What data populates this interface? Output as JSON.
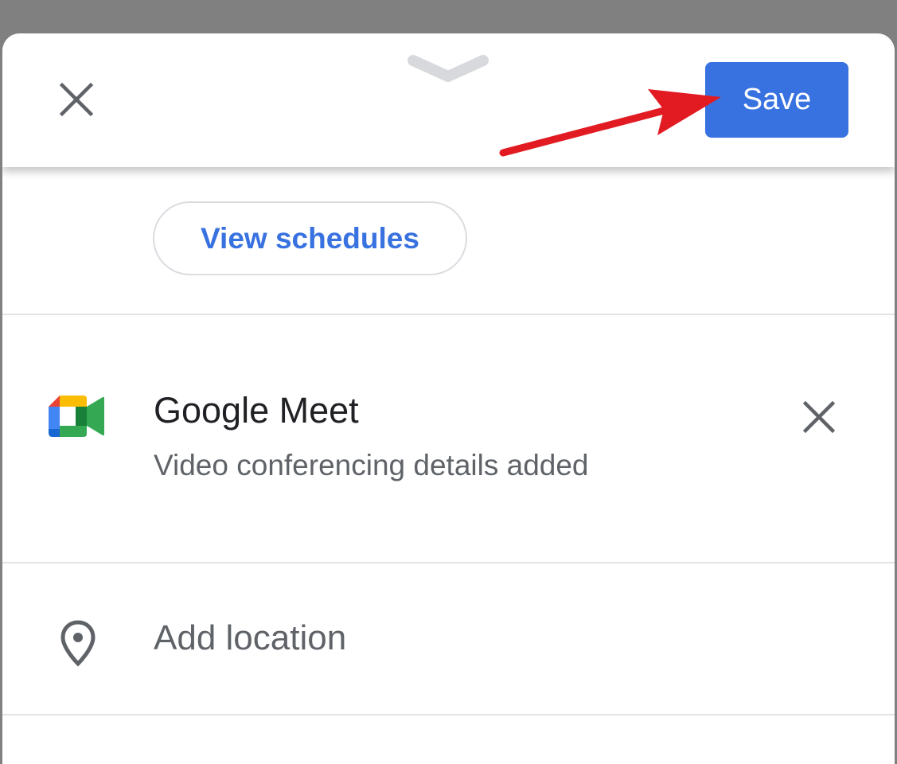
{
  "header": {
    "close_icon": "close-icon",
    "drag_handle_icon": "chevron-down-icon",
    "save_label": "Save",
    "accent_color": "#3871e0"
  },
  "annotation": {
    "arrow_color": "#e21b23"
  },
  "availability": {
    "view_schedules_label": "View schedules"
  },
  "conferencing": {
    "icon": "google-meet-icon",
    "title": "Google Meet",
    "subtitle": "Video conferencing details added",
    "remove_icon": "close-icon"
  },
  "location": {
    "icon": "location-pin-icon",
    "placeholder": "Add location"
  }
}
